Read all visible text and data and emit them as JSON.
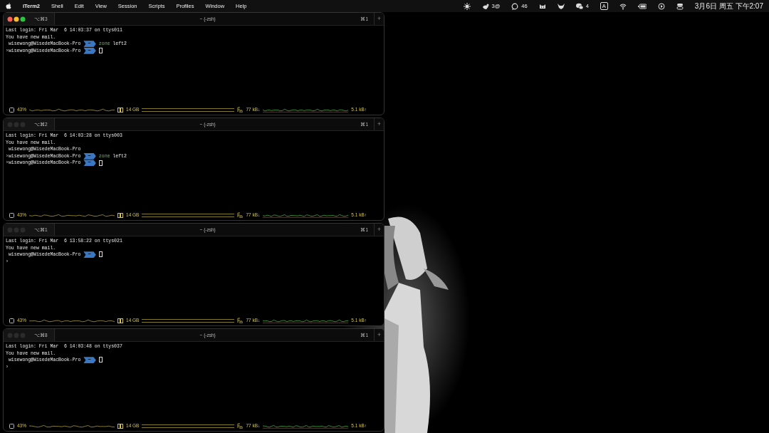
{
  "menu_bar": {
    "app": "iTerm2",
    "menus": [
      "Shell",
      "Edit",
      "View",
      "Session",
      "Scripts",
      "Profiles",
      "Window",
      "Help"
    ],
    "status_items": [
      {
        "kind": "sun"
      },
      {
        "kind": "bird",
        "text": "3@"
      },
      {
        "kind": "chat",
        "text": "46"
      },
      {
        "kind": "cat"
      },
      {
        "kind": "fox"
      },
      {
        "kind": "wechat",
        "text": "4"
      },
      {
        "kind": "input",
        "text": "A"
      },
      {
        "kind": "wifi"
      },
      {
        "kind": "battery"
      },
      {
        "kind": "play"
      },
      {
        "kind": "control"
      }
    ],
    "clock": "3月6日 周五  下午2:07"
  },
  "windows": [
    {
      "active": true,
      "tab_label": "⌥⌘3",
      "title": "~ (-zsh)",
      "shortcut": "⌘1",
      "new_tab": "+",
      "lines": [
        {
          "kind": "text",
          "text": "Last login: Fri Mar  6 14:03:37 on ttys011"
        },
        {
          "kind": "text",
          "text": "You have new mail."
        },
        {
          "kind": "prompt",
          "user": "wisewong@WisedeMacBook-Pro",
          "dir": "~",
          "command": "zone",
          "args": "left2"
        },
        {
          "kind": "prompt",
          "marker": "›",
          "user": "wisewong@WisedeMacBook-Pro",
          "dir": "~",
          "cursor": true
        }
      ],
      "status": {
        "cpu": "43%",
        "memory": "14 GB",
        "download": "77 kB↓",
        "upload": "5.1 kB↑"
      }
    },
    {
      "active": false,
      "tab_label": "⌥⌘2",
      "title": "~ (-zsh)",
      "shortcut": "⌘1",
      "new_tab": "+",
      "lines": [
        {
          "kind": "text",
          "text": "Last login: Fri Mar  6 14:03:28 on ttys003"
        },
        {
          "kind": "text",
          "text": "You have new mail."
        },
        {
          "kind": "prompt",
          "user": "wisewong@WisedeMacBook-Pro"
        },
        {
          "kind": "prompt",
          "marker": "›",
          "user": "wisewong@WisedeMacBook-Pro",
          "dir": "~",
          "command": "zone",
          "args": "left2"
        },
        {
          "kind": "prompt",
          "marker": "›",
          "user": "wisewong@WisedeMacBook-Pro",
          "dir": "~",
          "cursor": true
        }
      ],
      "status": {
        "cpu": "43%",
        "memory": "14 GB",
        "download": "77 kB↓",
        "upload": "5.1 kB↑"
      }
    },
    {
      "active": false,
      "tab_label": "⌥⌘1",
      "title": "~ (-zsh)",
      "shortcut": "⌘1",
      "new_tab": "+",
      "lines": [
        {
          "kind": "text",
          "text": "Last login: Fri Mar  6 13:58:22 on ttys021"
        },
        {
          "kind": "text",
          "text": "You have new mail."
        },
        {
          "kind": "prompt",
          "user": "wisewong@WisedeMacBook-Pro",
          "dir": "~",
          "cursor": true
        },
        {
          "kind": "marker",
          "marker": "›"
        }
      ],
      "status": {
        "cpu": "43%",
        "memory": "14 GB",
        "download": "77 kB↓",
        "upload": "5.1 kB↑"
      }
    },
    {
      "active": false,
      "tab_label": "⌥⌘8",
      "title": "~ (-zsh)",
      "shortcut": "⌘1",
      "new_tab": "+",
      "lines": [
        {
          "kind": "text",
          "text": "Last login: Fri Mar  6 14:03:48 on ttys037"
        },
        {
          "kind": "text",
          "text": "You have new mail."
        },
        {
          "kind": "prompt",
          "user": "wisewong@WisedeMacBook-Pro",
          "dir": "~",
          "cursor": true
        },
        {
          "kind": "marker",
          "marker": "›"
        }
      ],
      "status": {
        "cpu": "43%",
        "memory": "14 GB",
        "download": "77 kB↓",
        "upload": "5.1 kB↑"
      }
    }
  ]
}
